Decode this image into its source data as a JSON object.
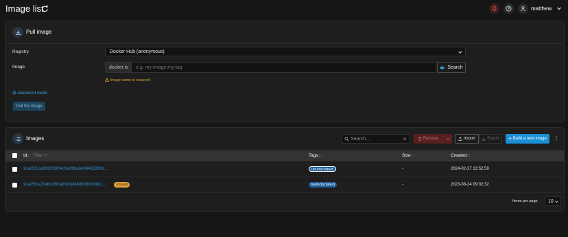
{
  "header": {
    "title": "Image list",
    "username": "matthew",
    "icons": [
      "refresh-icon",
      "bell-icon",
      "help-icon",
      "user-icon",
      "chevron-down-icon"
    ]
  },
  "pull_panel": {
    "title": "Pull image",
    "registry_label": "Registry",
    "registry_value": "Docker Hub (anonymous)",
    "image_label": "Image",
    "image_prefix": "docker.io",
    "image_placeholder": "e.g. my-image:my-tag",
    "search_button": "Search",
    "error_text": "Image name is required.",
    "advanced_mode": "Advanced mode",
    "pull_button": "Pull the image"
  },
  "images_panel": {
    "title": "Images",
    "search_placeholder": "Search...",
    "remove_button": "Remove",
    "import_button": "Import",
    "export_button": "Export",
    "build_button": "Build a new image",
    "columns": {
      "id": "Id",
      "filter": "Filter",
      "tags": "Tags",
      "size": "Size",
      "created": "Created"
    },
    "rows": [
      {
        "id": "sha256:ca2b0f26964cf2e80ba3e084d5983d...",
        "unused": "",
        "tag": "ubuntu:latest",
        "size": "-",
        "created": "2024-02-27 13:52:59"
      },
      {
        "id": "sha256:e23afbc992ab916ef46d9fdbcb08d1...",
        "unused": "Unused",
        "tag": "teamcity:latest",
        "size": "-",
        "created": "2023-08-24 09:02:32"
      }
    ],
    "items_per_page_label": "Items per page",
    "items_per_page_value": "10"
  },
  "colors": {
    "background": "#161616",
    "panel": "#1e1e1e",
    "accent": "#1a8fd6",
    "link": "#2e8ed1",
    "warning": "#e0a43a",
    "danger": "#5a1f1f"
  }
}
